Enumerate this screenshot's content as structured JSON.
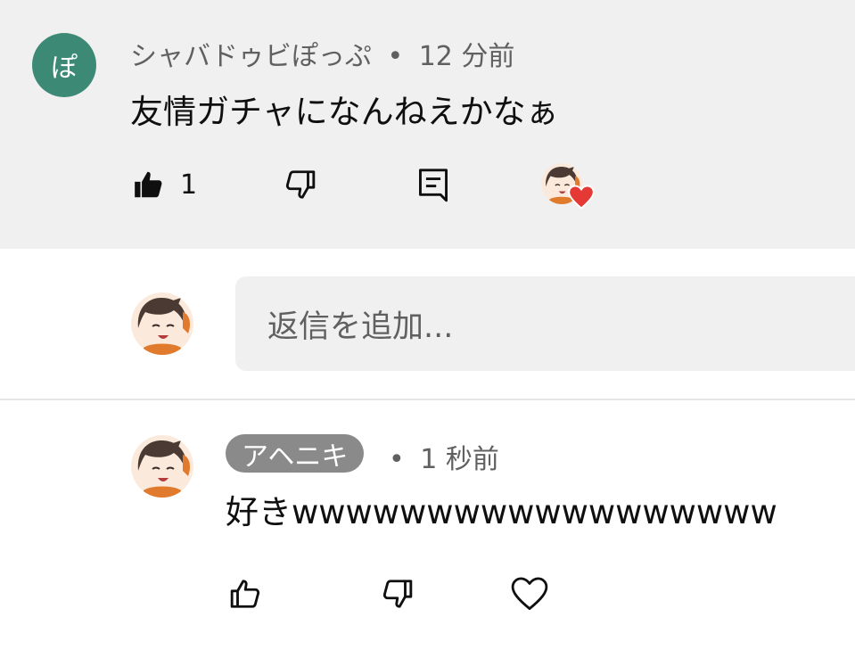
{
  "comment": {
    "avatar_letter": "ぽ",
    "author": "シャバドゥビぽっぷ",
    "separator": "•",
    "time": "12 分前",
    "text": "友情ガチャになんねえかなぁ",
    "like_count": "1"
  },
  "reply_input": {
    "placeholder": "返信を追加..."
  },
  "reply": {
    "author": "アヘニキ",
    "separator": "•",
    "time": "1 秒前",
    "text": "好きwwwwwwwwwwwwwwwwww"
  },
  "colors": {
    "avatar_bg": "#3c8a76",
    "heart": "#e53935",
    "author_pill": "#8a8a8a",
    "panel_bg": "#f0f0f0"
  }
}
